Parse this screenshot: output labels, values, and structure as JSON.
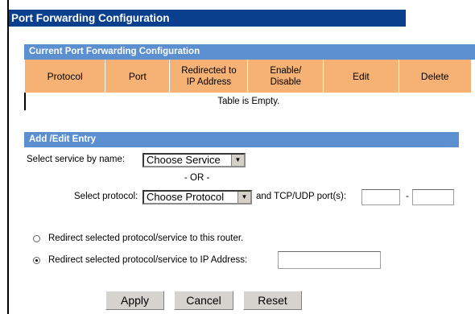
{
  "page": {
    "title": "Port Forwarding Configuration"
  },
  "current_section": {
    "title": "Current Port Forwarding Configuration",
    "columns": [
      "Protocol",
      "Port",
      "Redirected to IP Address",
      "Enable/ Disable",
      "Edit",
      "Delete"
    ],
    "empty_message": "Table is Empty."
  },
  "edit_section": {
    "title": "Add /Edit Entry",
    "service_label": "Select service by name:",
    "service_value": "Choose Service",
    "or_label": "- OR -",
    "protocol_label": "Select protocol:",
    "protocol_value": "Choose Protocol",
    "ports_label": "and TCP/UDP port(s):",
    "port_separator": "-",
    "port_from_value": "",
    "port_to_value": "",
    "radio_router_label": "Redirect selected protocol/service to this router.",
    "radio_ip_label": "Redirect selected protocol/service to IP Address:",
    "ip_value": "",
    "selected_radio": "ip"
  },
  "buttons": {
    "apply": "Apply",
    "cancel": "Cancel",
    "reset": "Reset"
  },
  "colors": {
    "title_bar": "#0a3f8e",
    "section_bar": "#5b8fd0",
    "table_header": "#f5b274"
  }
}
